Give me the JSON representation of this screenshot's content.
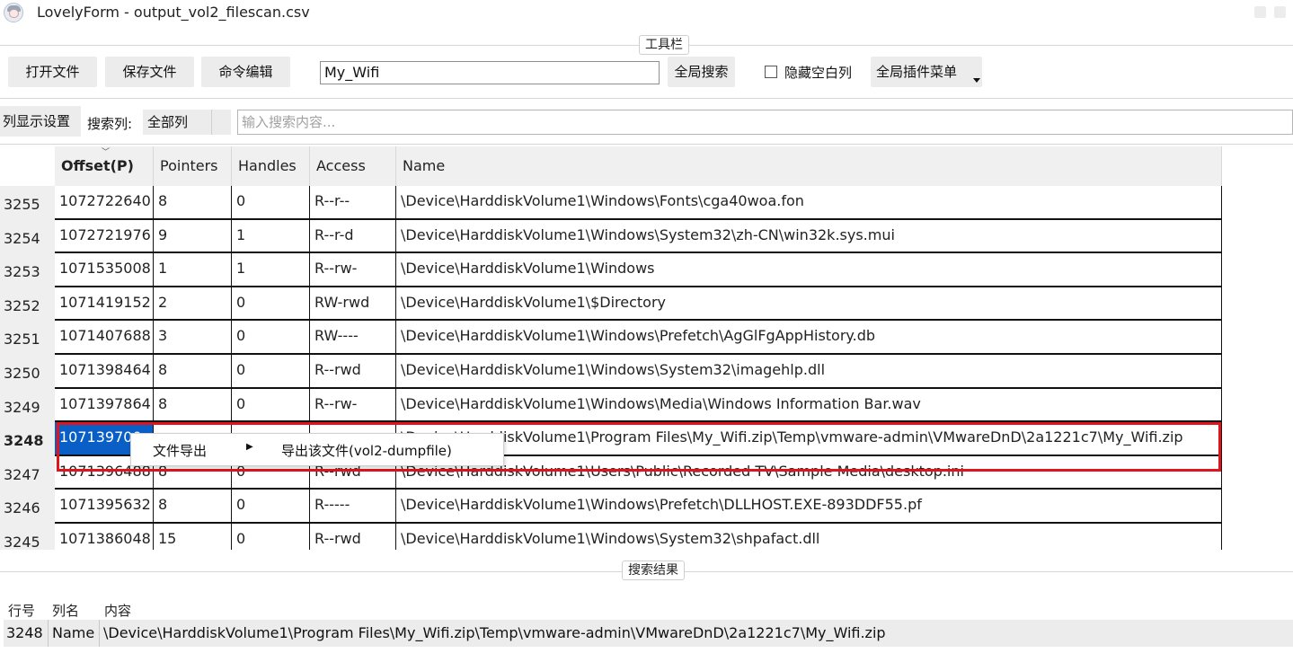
{
  "window": {
    "title": "LovelyForm - output_vol2_filescan.csv"
  },
  "toolbar": {
    "caption": "工具栏",
    "open_file": "打开文件",
    "save_file": "保存文件",
    "command_edit": "命令编辑",
    "search_value": "My_Wifi",
    "global_search": "全局搜索",
    "hide_empty_cols": "隐藏空白列",
    "hide_empty_checked": false,
    "global_plugin_menu": "全局插件菜单"
  },
  "search_row": {
    "column_settings": "列显示设置",
    "search_column_label": "搜索列:",
    "search_column_value": "全部列",
    "search_placeholder": "输入搜索内容..."
  },
  "table": {
    "headers": [
      "Offset(P)",
      "Pointers",
      "Handles",
      "Access",
      "Name"
    ],
    "sorted_column": "Offset(P)",
    "rows": [
      {
        "num": "3255",
        "offset": "1072722640",
        "pointers": "8",
        "handles": "0",
        "access": "R--r--",
        "name": "\\Device\\HarddiskVolume1\\Windows\\Fonts\\cga40woa.fon"
      },
      {
        "num": "3254",
        "offset": "1072721976",
        "pointers": "9",
        "handles": "1",
        "access": "R--r-d",
        "name": "\\Device\\HarddiskVolume1\\Windows\\System32\\zh-CN\\win32k.sys.mui"
      },
      {
        "num": "3253",
        "offset": "1071535008",
        "pointers": "1",
        "handles": "1",
        "access": "R--rw-",
        "name": "\\Device\\HarddiskVolume1\\Windows"
      },
      {
        "num": "3252",
        "offset": "1071419152",
        "pointers": "2",
        "handles": "0",
        "access": "RW-rwd",
        "name": "\\Device\\HarddiskVolume1\\$Directory"
      },
      {
        "num": "3251",
        "offset": "1071407688",
        "pointers": "3",
        "handles": "0",
        "access": "RW----",
        "name": "\\Device\\HarddiskVolume1\\Windows\\Prefetch\\AgGlFgAppHistory.db"
      },
      {
        "num": "3250",
        "offset": "1071398464",
        "pointers": "8",
        "handles": "0",
        "access": "R--rwd",
        "name": "\\Device\\HarddiskVolume1\\Windows\\System32\\imagehlp.dll"
      },
      {
        "num": "3249",
        "offset": "1071397864",
        "pointers": "8",
        "handles": "0",
        "access": "R--rw-",
        "name": "\\Device\\HarddiskVolume1\\Windows\\Media\\Windows Information Bar.wav"
      },
      {
        "num": "3248",
        "offset": "107139700",
        "pointers": "",
        "handles": "",
        "access": "",
        "name": "\\Device\\HarddiskVolume1\\Program Files\\My_Wifi.zip\\Temp\\vmware-admin\\VMwareDnD\\2a1221c7\\My_Wifi.zip",
        "selected": true
      },
      {
        "num": "3247",
        "offset": "1071396488",
        "pointers": "8",
        "handles": "0",
        "access": "R--rwd",
        "name": "\\Device\\HarddiskVolume1\\Users\\Public\\Recorded TV\\Sample Media\\desktop.ini"
      },
      {
        "num": "3246",
        "offset": "1071395632",
        "pointers": "8",
        "handles": "0",
        "access": "R-----",
        "name": "\\Device\\HarddiskVolume1\\Windows\\Prefetch\\DLLHOST.EXE-893DDF55.pf"
      },
      {
        "num": "3245",
        "offset": "1071386048",
        "pointers": "15",
        "handles": "0",
        "access": "R--rwd",
        "name": "\\Device\\HarddiskVolume1\\Windows\\System32\\shpafact.dll"
      }
    ]
  },
  "context_menu": {
    "file_export": "文件导出",
    "submenu_arrow": "▶",
    "dump_file": "导出该文件(vol2-dumpfile)"
  },
  "results": {
    "caption": "搜索结果",
    "headers": [
      "行号",
      "列名",
      "内容"
    ],
    "rows": [
      {
        "row": "3248",
        "column": "Name",
        "content": "\\Device\\HarddiskVolume1\\Program Files\\My_Wifi.zip\\Temp\\vmware-admin\\VMwareDnD\\2a1221c7\\My_Wifi.zip"
      }
    ]
  },
  "colors": {
    "selection": "#0a5fc7",
    "highlight_box": "#e0141a",
    "button_bg": "#ececec"
  }
}
